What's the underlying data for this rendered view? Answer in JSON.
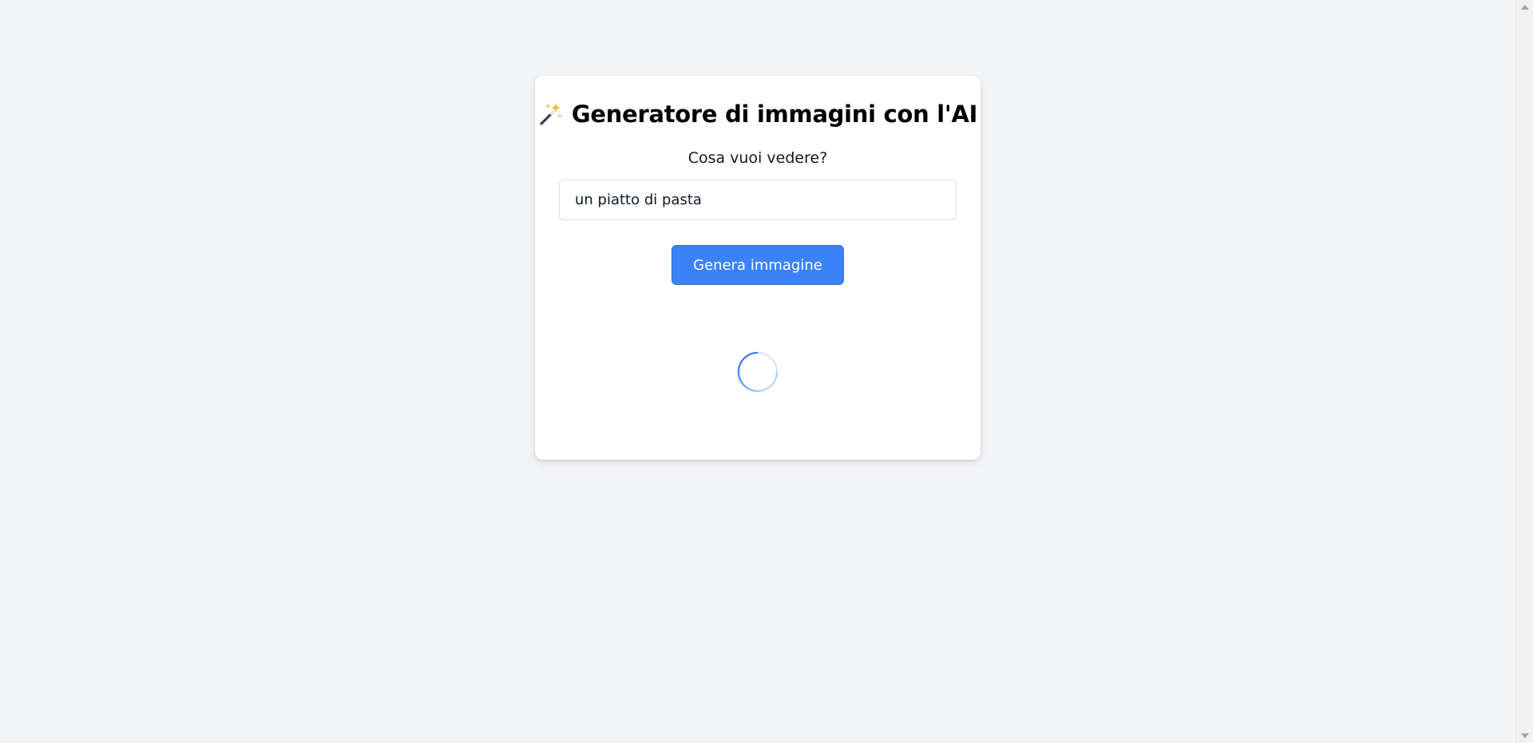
{
  "app": {
    "icon": "magic-wand-sparkles-icon",
    "title": "Generatore di immagini con l'AI"
  },
  "form": {
    "prompt_label": "Cosa vuoi vedere?",
    "prompt_value": "un piatto di pasta",
    "generate_label": "Genera immagine"
  },
  "status": {
    "loading": true,
    "spinner_icon": "loading-spinner-icon"
  },
  "colors": {
    "background": "#f3f4f6",
    "card": "#ffffff",
    "accent": "#3b82f6",
    "text": "#111827"
  }
}
